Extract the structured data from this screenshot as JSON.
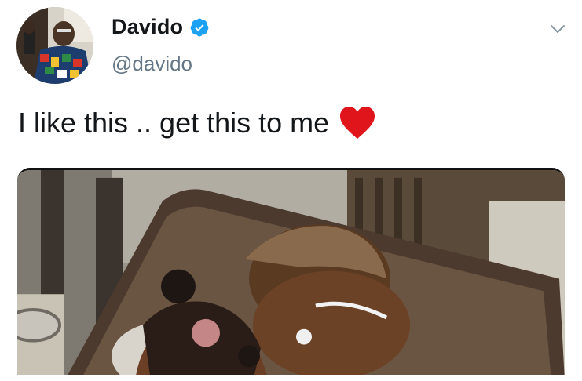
{
  "tweet": {
    "author": {
      "display_name": "Davido",
      "handle": "@davido",
      "verified": true
    },
    "text": "I like this .. get this to me",
    "emoji": "heart-icon",
    "colors": {
      "verified": "#1DA1F2",
      "heart": "#E0151C",
      "handle": "#657786",
      "text": "#14171A"
    }
  }
}
